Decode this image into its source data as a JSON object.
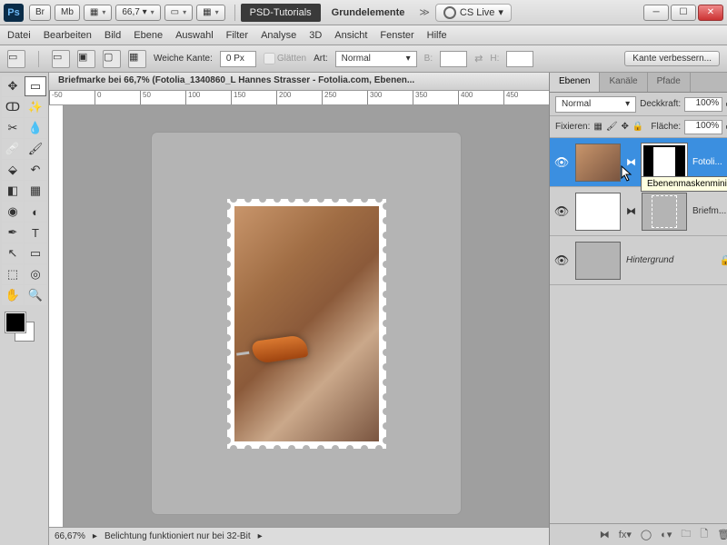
{
  "titlebar": {
    "ps": "Ps",
    "br": "Br",
    "mb": "Mb",
    "zoom": "66,7",
    "tab1": "PSD-Tutorials",
    "tab2": "Grundelemente",
    "cslive": "CS Live"
  },
  "menu": [
    "Datei",
    "Bearbeiten",
    "Bild",
    "Ebene",
    "Auswahl",
    "Filter",
    "Analyse",
    "3D",
    "Ansicht",
    "Fenster",
    "Hilfe"
  ],
  "options": {
    "weiche_kante_label": "Weiche Kante:",
    "weiche_kante_value": "0 Px",
    "glaetten": "Glätten",
    "art_label": "Art:",
    "art_value": "Normal",
    "b_label": "B:",
    "h_label": "H:",
    "refine": "Kante verbessern..."
  },
  "document": {
    "tab": "Briefmarke bei 66,7% (Fotolia_1340860_L Hannes Strasser - Fotolia.com, Ebenen...",
    "ruler_marks": [
      "-50",
      "0",
      "50",
      "100",
      "150",
      "200",
      "250",
      "300",
      "350",
      "400",
      "450"
    ]
  },
  "status": {
    "zoom": "66,67%",
    "info": "Belichtung funktioniert nur bei 32-Bit"
  },
  "layers_panel": {
    "tabs": [
      "Ebenen",
      "Kanäle",
      "Pfade"
    ],
    "blend": "Normal",
    "opacity_label": "Deckkraft:",
    "opacity": "100%",
    "lock_label": "Fixieren:",
    "fill_label": "Fläche:",
    "fill": "100%",
    "tooltip": "Ebenenmaskenminiatur",
    "layers": [
      {
        "name": "Fotoli..."
      },
      {
        "name": "Briefm..."
      },
      {
        "name": "Hintergrund"
      }
    ]
  }
}
